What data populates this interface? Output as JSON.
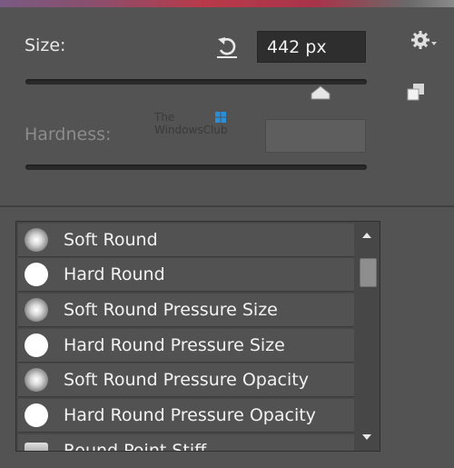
{
  "brush": {
    "size_label": "Size:",
    "size_value": "442 px",
    "size_slider_fraction": 0.9,
    "hardness_label": "Hardness:",
    "hardness_value": ""
  },
  "watermark": {
    "line1": "The",
    "line2": "WindowsClub"
  },
  "presets": [
    {
      "label": "Soft Round",
      "tip": "soft"
    },
    {
      "label": "Hard Round",
      "tip": "hard"
    },
    {
      "label": "Soft Round Pressure Size",
      "tip": "soft"
    },
    {
      "label": "Hard Round Pressure Size",
      "tip": "hard"
    },
    {
      "label": "Soft Round Pressure Opacity",
      "tip": "soft"
    },
    {
      "label": "Hard Round Pressure Opacity",
      "tip": "hard"
    },
    {
      "label": "Round Point Stiff",
      "tip": "stiff"
    }
  ],
  "icons": {
    "reset": "reset-arrow-icon",
    "gear": "gear-icon",
    "new_preset": "new-preset-icon",
    "scroll_up": "scroll-up-icon",
    "scroll_down": "scroll-down-icon"
  },
  "colors": {
    "panel": "#535353",
    "field": "#2e2e2e",
    "list": "#474747"
  }
}
